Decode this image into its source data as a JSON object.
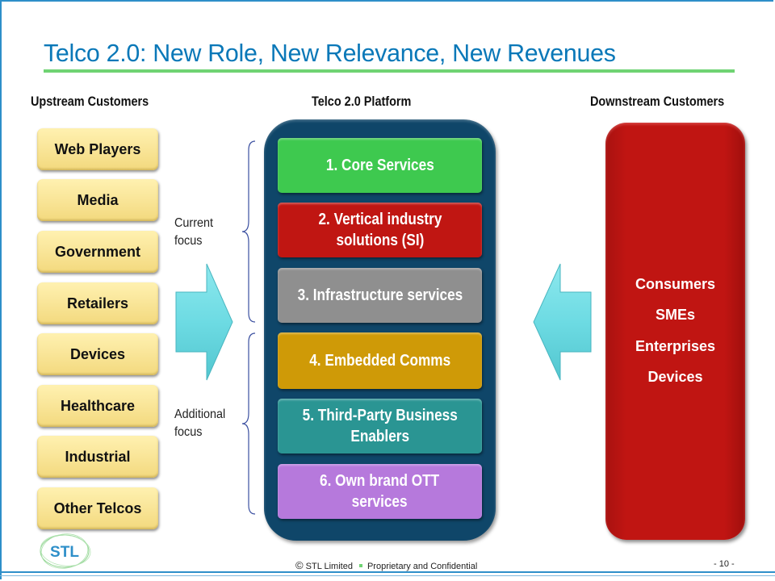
{
  "title": "Telco 2.0: New Role, New Relevance, New Revenues",
  "columns": {
    "upstream": "Upstream Customers",
    "platform": "Telco 2.0 Platform",
    "downstream": "Downstream Customers"
  },
  "upstream_customers": [
    "Web Players",
    "Media",
    "Government",
    "Retailers",
    "Devices",
    "Healthcare",
    "Industrial",
    "Other Telcos"
  ],
  "focus_labels": {
    "current": [
      "Current",
      "focus"
    ],
    "additional": [
      "Additional",
      "focus"
    ]
  },
  "platform_services": [
    {
      "lines": [
        "1. Core Services"
      ],
      "color": "#3ec94f"
    },
    {
      "lines": [
        "2. Vertical industry",
        "solutions (SI)"
      ],
      "color": "#c01612"
    },
    {
      "lines": [
        "3. Infrastructure services"
      ],
      "color": "#8f8f8f"
    },
    {
      "lines": [
        "4. Embedded Comms"
      ],
      "color": "#cf9a07"
    },
    {
      "lines": [
        "5. Third-Party Business",
        "Enablers"
      ],
      "color": "#2a9593"
    },
    {
      "lines": [
        "6. Own brand OTT",
        "services"
      ],
      "color": "#b679dc"
    }
  ],
  "downstream_customers": [
    "Consumers",
    "SMEs",
    "Enterprises",
    "Devices"
  ],
  "footer": {
    "copyright_symbol": "©",
    "company": "STL Limited",
    "confidentiality": "Proprietary and Confidential",
    "page": "- 10 -"
  },
  "logo_text": "STL",
  "colors": {
    "title": "#0a78b8",
    "title_rule": "#6fd373",
    "platform_bg": "#0f4669",
    "downstream_bg": "#c01512",
    "arrow": "#6ddbe3"
  }
}
